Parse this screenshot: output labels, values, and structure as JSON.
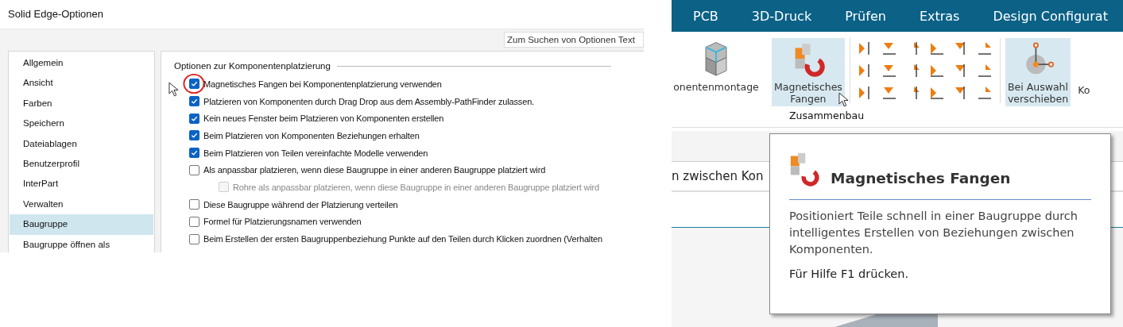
{
  "left_window": {
    "title": "Solid Edge-Optionen",
    "search": {
      "placeholder": "Zum Suchen von Optionen Text"
    },
    "sidebar": {
      "items": [
        {
          "label": "Allgemein",
          "selected": false
        },
        {
          "label": "Ansicht",
          "selected": false
        },
        {
          "label": "Farben",
          "selected": false
        },
        {
          "label": "Speichern",
          "selected": false
        },
        {
          "label": "Dateiablagen",
          "selected": false
        },
        {
          "label": "Benutzerprofil",
          "selected": false
        },
        {
          "label": "InterPart",
          "selected": false
        },
        {
          "label": "Verwalten",
          "selected": false
        },
        {
          "label": "Baugruppe",
          "selected": true
        },
        {
          "label": "Baugruppe öffnen als",
          "selected": false
        }
      ]
    },
    "section_title": "Optionen zur Komponentenplatzierung",
    "options": [
      {
        "label": "Magnetisches Fangen bei Komponentenplatzierung verwenden",
        "checked": true,
        "disabled": false,
        "highlighted": true
      },
      {
        "label": "Platzieren von Komponenten durch Drag  Drop aus dem Assembly-PathFinder zulassen.",
        "checked": true,
        "disabled": false
      },
      {
        "label": "Kein neues Fenster beim Platzieren von Komponenten erstellen",
        "checked": true,
        "disabled": false
      },
      {
        "label": "Beim Platzieren von Komponenten Beziehungen erhalten",
        "checked": true,
        "disabled": false
      },
      {
        "label": "Beim Platzieren von Teilen vereinfachte Modelle verwenden",
        "checked": true,
        "disabled": false
      },
      {
        "label": "Als anpassbar platzieren, wenn diese Baugruppe in einer anderen Baugruppe platziert wird",
        "checked": false,
        "disabled": false,
        "children": [
          {
            "label": "Rohre als anpassbar platzieren, wenn diese Baugruppe in einer anderen Baugruppe platziert wird",
            "checked": false,
            "disabled": true
          }
        ]
      },
      {
        "label": "Diese Baugruppe während der Platzierung verteilen",
        "checked": false,
        "disabled": false
      },
      {
        "label": "Formel für Platzierungsnamen verwenden",
        "checked": false,
        "disabled": false
      },
      {
        "label": "Beim Erstellen der ersten Baugruppenbeziehung Punkte auf den Teilen durch Klicken zuordnen (Verhalten",
        "checked": false,
        "disabled": false
      }
    ]
  },
  "right_window": {
    "ribbon_tabs": [
      {
        "label": "PCB",
        "selected": false
      },
      {
        "label": "3D-Druck",
        "selected": false
      },
      {
        "label": "Prüfen",
        "selected": false
      },
      {
        "label": "Extras",
        "selected": false
      },
      {
        "label": "Design Configurat",
        "selected": false
      }
    ],
    "ribbon_buttons": [
      {
        "kind": "cube",
        "lines": [
          "onentenmontage"
        ],
        "selected": false
      },
      {
        "kind": "magnet",
        "lines": [
          "Magnetisches",
          "Fangen"
        ],
        "selected": true
      },
      {
        "kind": "tools"
      },
      {
        "kind": "move",
        "lines": [
          "Bei Auswahl",
          "verschieben"
        ],
        "selected": true
      },
      {
        "kind": "text",
        "lines": [
          "Ko"
        ],
        "selected": false
      }
    ],
    "group_label": "Zusammenbau",
    "prompt_text": "n zwischen Kon",
    "tooltip": {
      "title": "Magnetisches Fangen",
      "description": "Positioniert Teile schnell in einer Baugruppe durch intelligentes Erstellen von Beziehungen zwischen Komponenten.",
      "help": "Für Hilfe F1 drücken."
    }
  }
}
